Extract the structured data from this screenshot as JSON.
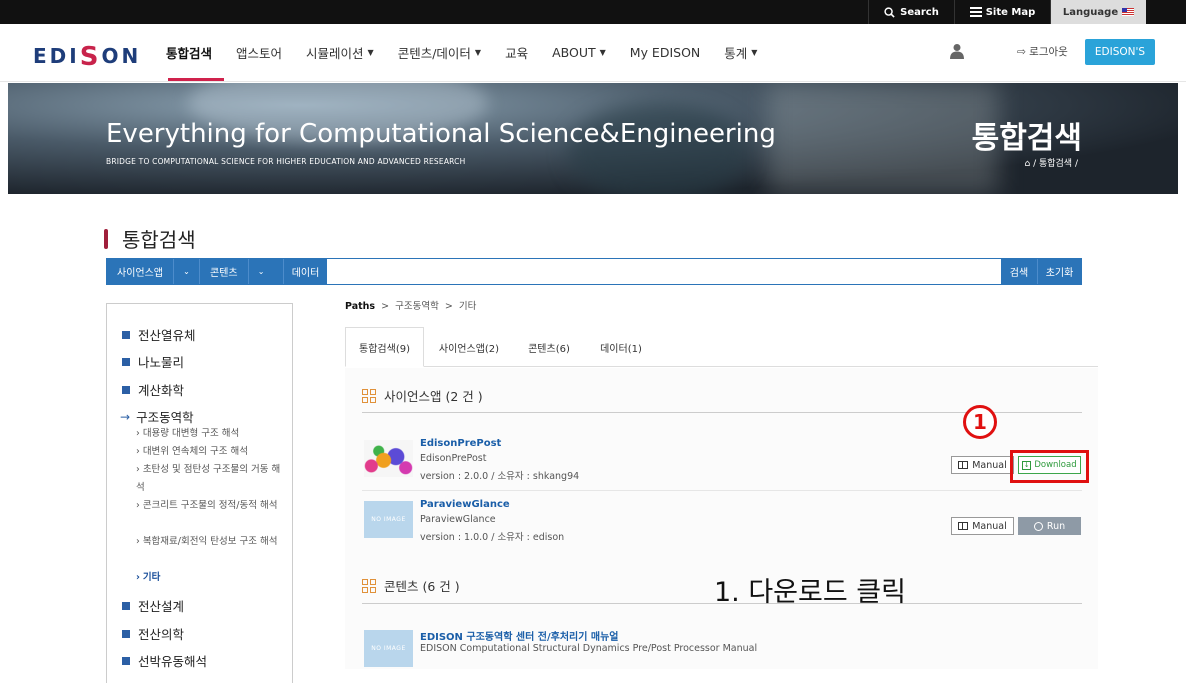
{
  "topbar": {
    "search_label": "Search",
    "sitemap_label": "Site Map",
    "language_label": "Language"
  },
  "nav": {
    "logo": "EDISON",
    "items": [
      {
        "label": "통합검색"
      },
      {
        "label": "앱스토어"
      },
      {
        "label": "시뮬레이션"
      },
      {
        "label": "콘텐츠/데이터"
      },
      {
        "label": "교육"
      },
      {
        "label": "ABOUT"
      },
      {
        "label": "My EDISON"
      },
      {
        "label": "통계"
      }
    ],
    "logout_label": "로그아웃",
    "edisons_label": "EDISON'S"
  },
  "banner": {
    "title": "Everything for Computational Science&Engineering",
    "subtitle": "BRIDGE TO COMPUTATIONAL SCIENCE FOR HIGHER EDUCATION AND ADVANCED RESEARCH",
    "page_title": "통합검색",
    "breadcrumb": "/ 통합검색 /"
  },
  "page": {
    "heading": "통합검색"
  },
  "searchbar": {
    "select1": "사이언스앱",
    "select2": "콘텐츠",
    "data_label": "데이터",
    "query": "",
    "search_label": "검색",
    "reset_label": "초기화"
  },
  "sidebar": {
    "cat1": "전산열유체",
    "cat2": "나노물리",
    "cat3": "계산화학",
    "cat4": "구조동역학",
    "sub1": "대용량 대변형 구조 해석",
    "sub2": "대변위 연속체의 구조 해석",
    "sub3": "초탄성 및 점탄성 구조물의 거동 해석",
    "sub4": "콘크리트 구조물의 정적/동적 해석",
    "sub5": "복합재료/회전익 탄성보 구조 해석",
    "sub6": "기타",
    "cat5": "전산설계",
    "cat6": "전산의학",
    "cat7": "선박유동해석"
  },
  "content": {
    "paths_label": "Paths",
    "path1": "구조동역학",
    "path2": "기타",
    "tabs": [
      {
        "label": "통합검색(9)"
      },
      {
        "label": "사이언스앱(2)"
      },
      {
        "label": "콘텐츠(6)"
      },
      {
        "label": "데이터(1)"
      }
    ],
    "section_apps": "사이언스앱 (2 건 )",
    "section_contents": "콘텐츠 (6 건 )",
    "apps": [
      {
        "name": "EdisonPrePost",
        "desc": "EdisonPrePost",
        "version": "version : 2.0.0 / 소유자 : shkang94",
        "manual_label": "Manual",
        "action_label": "Download"
      },
      {
        "name": "ParaviewGlance",
        "desc": "ParaviewGlance",
        "version": "version : 1.0.0 / 소유자 : edison",
        "manual_label": "Manual",
        "action_label": "Run",
        "thumb": "NO IMAGE"
      }
    ],
    "content_item": {
      "name": "EDISON 구조동역학 센터 전/후처리기 매뉴얼",
      "desc": "EDISON Computational Structural Dynamics Pre/Post Processor Manual",
      "thumb": "NO IMAGE"
    }
  },
  "annotation": {
    "badge": "1",
    "note": "1. 다운로드 클릭",
    "highlight_color": "#e01010"
  }
}
